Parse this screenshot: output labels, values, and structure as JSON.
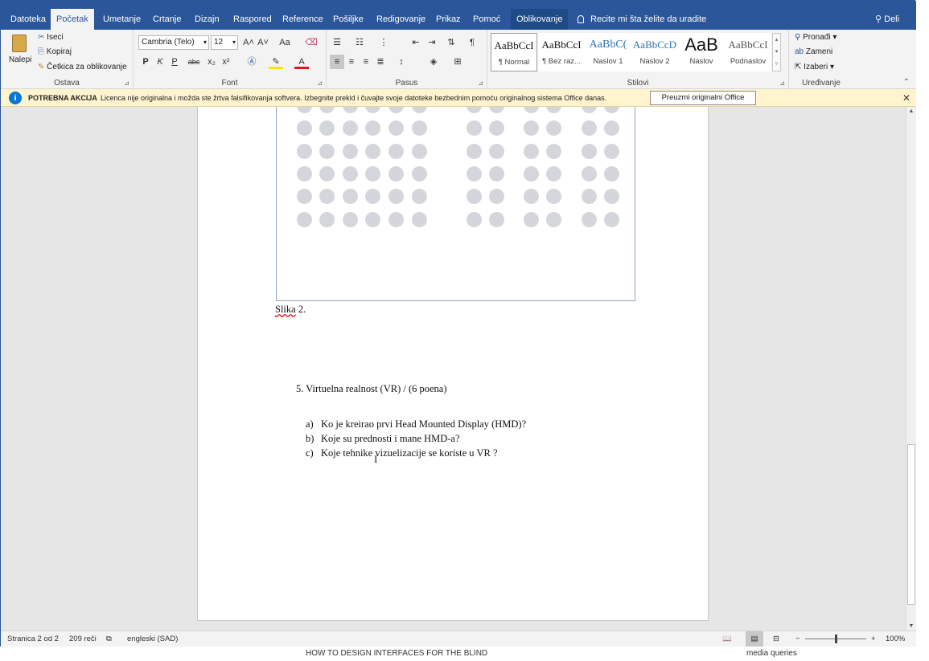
{
  "tabs": [
    "Datoteka",
    "Početak",
    "Umetanje",
    "Crtanje",
    "Dizajn",
    "Raspored",
    "Reference",
    "Pošiljke",
    "Redigovanje",
    "Prikaz",
    "Pomoć",
    "Oblikovanje"
  ],
  "tell_me": "Recite mi šta želite da uradite",
  "share": "Deli",
  "clipboard": {
    "paste": "Nalepi",
    "cut": "Iseci",
    "copy": "Kopiraj",
    "format_painter": "Četkica za oblikovanje",
    "label": "Ostava"
  },
  "font": {
    "name": "Cambria (Telo)",
    "size": "12",
    "label": "Font",
    "bold": "P",
    "italic": "K",
    "underline": "P",
    "strike": "abc",
    "sub": "x₂",
    "sup": "x²",
    "grow": "A˄",
    "shrink": "A˅",
    "case": "Aa",
    "color": "A"
  },
  "paragraph": {
    "label": "Pasus"
  },
  "styles": {
    "label": "Stilovi",
    "items": [
      {
        "preview": "AaBbCcI",
        "name": "¶ Normal"
      },
      {
        "preview": "AaBbCcI",
        "name": "¶ Bez raz..."
      },
      {
        "preview": "AaBbC(",
        "name": "Naslov 1"
      },
      {
        "preview": "AaBbCcD",
        "name": "Naslov 2"
      },
      {
        "preview": "AaB",
        "name": "Naslov"
      },
      {
        "preview": "AaBbCcI",
        "name": "Podnaslov"
      }
    ]
  },
  "editing": {
    "find": "Pronađi",
    "replace": "Zameni",
    "select": "Izaberi",
    "label": "Uređivanje"
  },
  "notice": {
    "title": "POTREBNA AKCIJA",
    "text": "Licenca nije originalna i možda ste žrtva falsifikovanja softvera. Izbegnite prekid i čuvajte svoje datoteke bezbednim pomoću originalnog sistema Office danas.",
    "button": "Preuzmi originalni Office"
  },
  "document": {
    "caption_word": "Slika",
    "caption_num": "2.",
    "question_heading": "5. Virtuelna realnost (VR)  / (6 poena)",
    "items": [
      {
        "marker": "a)",
        "text": "Ko je kreirao prvi Head Mounted Display (HMD)?"
      },
      {
        "marker": "b)",
        "text": "Koje su prednosti i mane HMD-a?"
      },
      {
        "marker": "c)",
        "text": "Koje tehnike vizuelizacije se koriste u VR ?"
      }
    ]
  },
  "status": {
    "page": "Stranica 2 od 2",
    "words": "209 reči",
    "language": "engleski (SAD)",
    "zoom": "100%"
  },
  "below": {
    "left": "HOW TO DESIGN INTERFACES FOR THE BLIND",
    "right": "media queries"
  },
  "colors": {
    "accent": "#2b579a",
    "notice_bg": "#fff4ce",
    "info_icon": "#0078d4",
    "dot": "#d4d6dc"
  }
}
